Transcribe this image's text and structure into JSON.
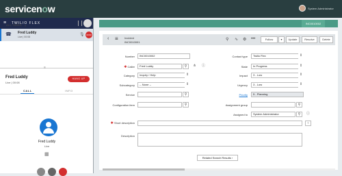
{
  "app": {
    "logo_part1": "servicen",
    "logo_o": "o",
    "logo_part2": "w",
    "user_name": "System Administrator"
  },
  "flex": {
    "title": "TWILIO FLEX",
    "task": {
      "name": "Fred Luddy",
      "status": "Live | 00:08",
      "timer": "00:00"
    },
    "all_tasks": "ALL TASKS",
    "call": {
      "name": "Fred Luddy",
      "status": "Live | 00:08",
      "hangup": "HANG UP"
    },
    "tabs": {
      "call": "CALL",
      "info": "INFO"
    },
    "caller": {
      "name": "Fred Luddy",
      "status": "Live"
    }
  },
  "record_tab": "INC0010002",
  "form": {
    "header_title": "Incident",
    "header_number": "INC0010001",
    "buttons": {
      "follow": "Follow",
      "update": "Update",
      "resolve": "Resolve",
      "delete": "Delete"
    },
    "left": {
      "number_label": "Number",
      "number_value": "INC0010002",
      "caller_label": "Caller",
      "caller_value": "Fred Luddy",
      "category_label": "Category",
      "category_value": "Inquiry / Help",
      "subcategory_label": "Subcategory",
      "subcategory_value": "-- None --",
      "service_label": "Service",
      "service_value": "",
      "ci_label": "Configuration item",
      "ci_value": ""
    },
    "right": {
      "contact_label": "Contact type",
      "contact_value": "Twilio Flex",
      "state_label": "State",
      "state_value": "In Progress",
      "impact_label": "Impact",
      "impact_value": "3 - Low",
      "urgency_label": "Urgency",
      "urgency_value": "3 - Low",
      "priority_label": "Priority",
      "priority_value": "5 - Planning",
      "group_label": "Assignment group",
      "group_value": "",
      "assigned_label": "Assigned to",
      "assigned_value": "System Administrator"
    },
    "short_desc_label": "Short description",
    "description_label": "Description",
    "related_button": "Related Search Results"
  }
}
